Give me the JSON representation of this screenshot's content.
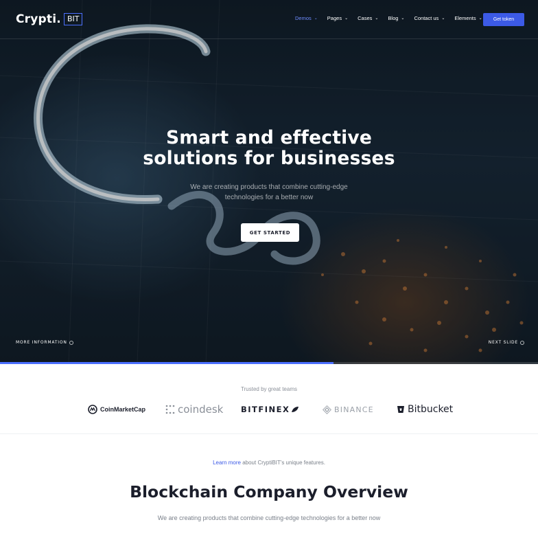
{
  "colors": {
    "accent": "#3c5ae6",
    "nav_active": "#6f8dff",
    "dark_text": "#1b1e2b",
    "muted": "#8a8f98"
  },
  "logo": {
    "name": "Crypti.",
    "badge": "BIT"
  },
  "nav": {
    "items": [
      {
        "label": "Demos",
        "icon": "chevron-down-icon",
        "active": true
      },
      {
        "label": "Pages",
        "icon": "chevron-down-icon"
      },
      {
        "label": "Cases",
        "icon": "chevron-down-icon"
      },
      {
        "label": "Blog",
        "icon": "chevron-down-icon"
      },
      {
        "label": "Contact us",
        "icon": "chevron-down-icon"
      },
      {
        "label": "Elements",
        "icon": "chevron-down-icon"
      }
    ],
    "cta": "Get token"
  },
  "hero": {
    "title_line1": "Smart and effective",
    "title_line2": "solutions for businesses",
    "subtitle": "We are creating products that combine cutting-edge technologies for a better now",
    "button": "GET STARTED",
    "more_info": "MORE INFORMATION",
    "next_slide": "NEXT SLIDE",
    "slide_progress": 0.62
  },
  "trusted": {
    "label": "Trusted by great teams",
    "partners": [
      "CoinMarketCap",
      "coindesk",
      "BITFINEX",
      "BINANCE",
      "Bitbucket"
    ]
  },
  "overview": {
    "learn_link": "Learn more",
    "learn_rest": " about CryptiBIT's unique features.",
    "title": "Blockchain Company Overview",
    "subtitle": "We are creating products that combine cutting-edge technologies for a better now"
  }
}
